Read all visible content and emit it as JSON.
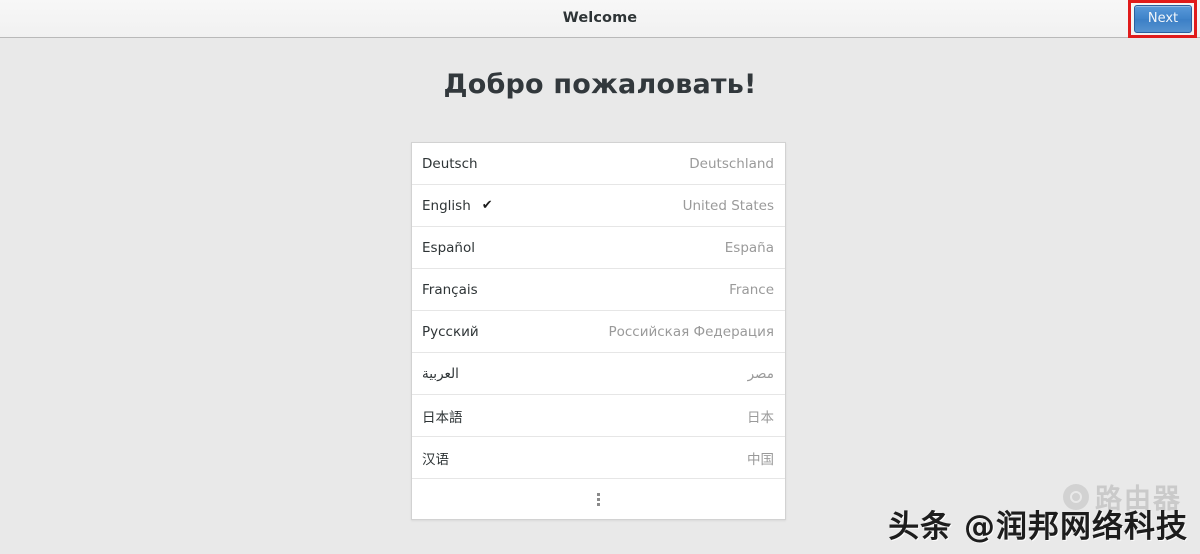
{
  "window": {
    "title": "Welcome"
  },
  "toolbar": {
    "next_label": "Next"
  },
  "main": {
    "heading": "Добро пожаловать!"
  },
  "language_list": {
    "rows": [
      {
        "language": "Deutsch",
        "region": "Deutschland",
        "selected": false,
        "rtl": false
      },
      {
        "language": "English",
        "region": "United States",
        "selected": true,
        "rtl": false
      },
      {
        "language": "Español",
        "region": "España",
        "selected": false,
        "rtl": false
      },
      {
        "language": "Français",
        "region": "France",
        "selected": false,
        "rtl": false
      },
      {
        "language": "Русский",
        "region": "Российская Федерация",
        "selected": false,
        "rtl": false
      },
      {
        "language": "العربية",
        "region": "مصر",
        "selected": false,
        "rtl": true
      },
      {
        "language": "日本語",
        "region": "日本",
        "selected": false,
        "rtl": false
      },
      {
        "language": "汉语",
        "region": "中国",
        "selected": false,
        "rtl": false
      }
    ],
    "check_glyph": "✔",
    "more_label": "⋮"
  },
  "watermark": {
    "primary": "头条 @润邦网络科技",
    "secondary": "路由器"
  },
  "colors": {
    "accent_blue": "#3f83c9",
    "highlight_red": "#e01b1b",
    "page_background": "#e9e9e9",
    "list_background": "#ffffff",
    "region_text": "#9a9a9a"
  }
}
